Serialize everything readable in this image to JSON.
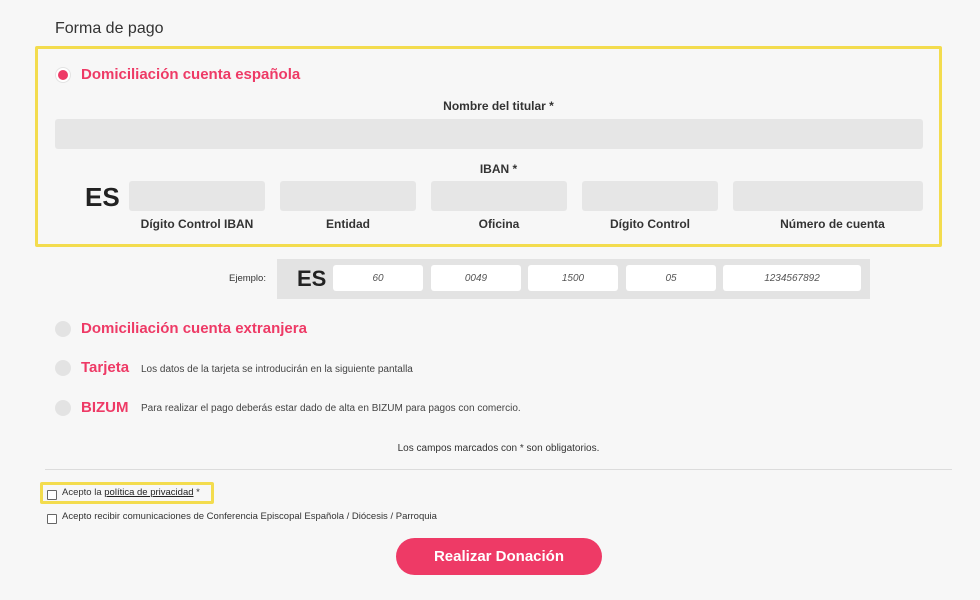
{
  "section_title": "Forma de pago",
  "options": {
    "domestic": {
      "label": "Domiciliación cuenta española",
      "selected": true
    },
    "foreign": {
      "label": "Domiciliación cuenta extranjera"
    },
    "card": {
      "label": "Tarjeta",
      "desc": "Los datos de la tarjeta se introducirán en la siguiente pantalla"
    },
    "bizum": {
      "label": "BIZUM",
      "desc": "Para realizar el pago deberás estar dado de alta en BIZUM para pagos con comercio."
    }
  },
  "holder": {
    "label": "Nombre del titular *",
    "value": ""
  },
  "iban": {
    "label": "IBAN *",
    "country": "ES",
    "fields": [
      {
        "label": "Dígito Control IBAN",
        "value": ""
      },
      {
        "label": "Entidad",
        "value": ""
      },
      {
        "label": "Oficina",
        "value": ""
      },
      {
        "label": "Dígito Control",
        "value": ""
      },
      {
        "label": "Número de cuenta",
        "value": ""
      }
    ]
  },
  "example": {
    "label": "Ejemplo:",
    "country": "ES",
    "values": [
      "60",
      "0049",
      "1500",
      "05",
      "1234567892"
    ]
  },
  "required_note": "Los campos marcados con * son obligatorios.",
  "consents": {
    "privacy_prefix": "Acepto la",
    "privacy_link": "política de privacidad",
    "privacy_suffix": "*",
    "communications": "Acepto recibir comunicaciones de Conferencia Episcopal Española / Diócesis / Parroquia"
  },
  "submit_label": "Realizar Donación",
  "colors": {
    "accent": "#ee3a66",
    "highlight": "#f3dc4e",
    "input_bg": "#e6e6e6"
  }
}
